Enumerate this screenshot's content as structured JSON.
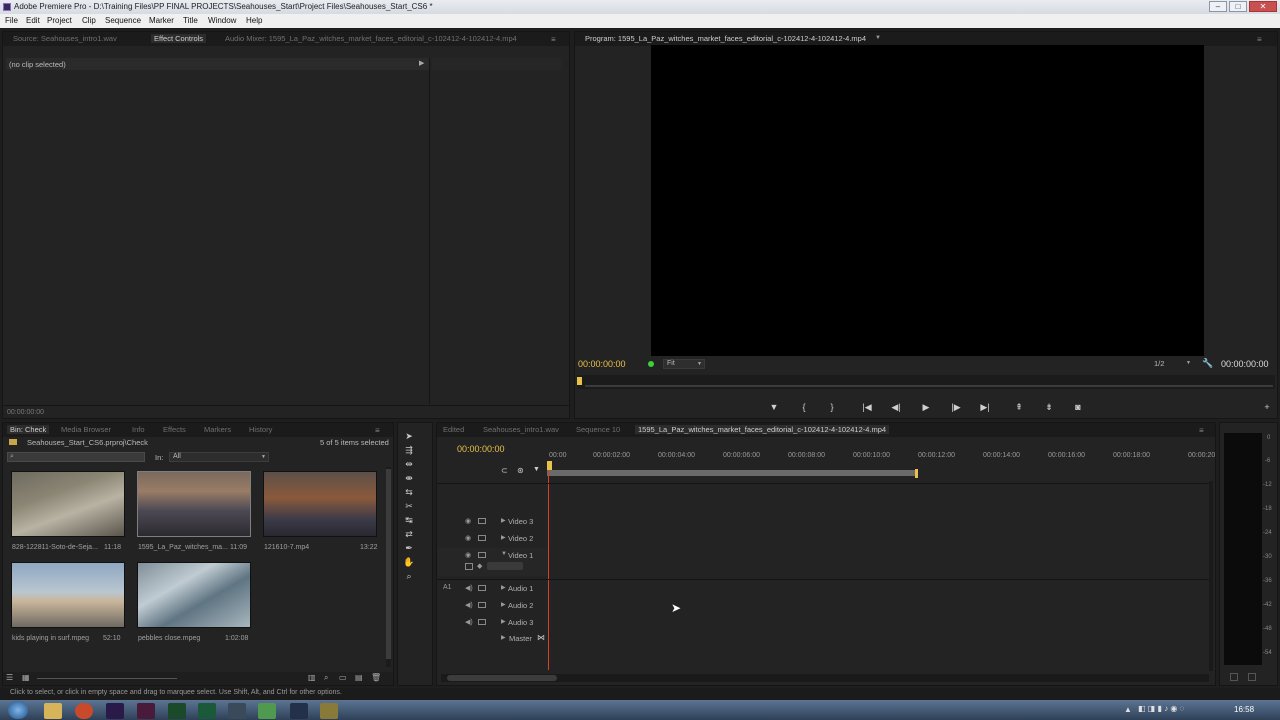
{
  "window": {
    "title": "Adobe Premiere Pro - D:\\Training Files\\PP FINAL PROJECTS\\Seahouses_Start\\Project Files\\Seahouses_Start_CS6 *"
  },
  "menu": [
    "File",
    "Edit",
    "Project",
    "Clip",
    "Sequence",
    "Marker",
    "Title",
    "Window",
    "Help"
  ],
  "source_panel": {
    "tabs": [
      "Source: Seahouses_intro1.wav",
      "Effect Controls",
      "Audio Mixer: 1595_La_Paz_witches_market_faces_editorial_c-102412-4-102412-4.mp4"
    ],
    "active_tab": 1,
    "no_clip": "(no clip selected)",
    "timecode": "00:00:00:00"
  },
  "program_monitor": {
    "title": "Program: 1595_La_Paz_witches_market_faces_editorial_c-102412-4-102412-4.mp4",
    "timecode_left": "00:00:00:00",
    "fit": "Fit",
    "resolution": "1/2",
    "timecode_right": "00:00:00:00"
  },
  "project_panel": {
    "tabs": [
      "Bin: Check",
      "Media Browser",
      "Info",
      "Effects",
      "Markers",
      "History"
    ],
    "active_tab": 0,
    "path": "Seahouses_Start_CS6.prproj\\Check",
    "items_selected": "5 of 5 items selected",
    "in_label": "In:",
    "in_value": "All",
    "clips": [
      {
        "name": "828-122811-Soto-de-Seja...",
        "duration": "11:18"
      },
      {
        "name": "1595_La_Paz_witches_ma...",
        "duration": "11:09"
      },
      {
        "name": "121610-7.mp4",
        "duration": "13:22"
      },
      {
        "name": "kids playing in surf.mpeg",
        "duration": "52:10"
      },
      {
        "name": "pebbles close.mpeg",
        "duration": "1:02:08"
      }
    ]
  },
  "timeline": {
    "tabs": [
      "Edited",
      "Seahouses_intro1.wav",
      "Sequence 10",
      "1595_La_Paz_witches_market_faces_editorial_c-102412-4-102412-4.mp4"
    ],
    "active_tab": 3,
    "timecode": "00:00:00:00",
    "ruler": [
      "00:00",
      "00:00:02:00",
      "00:00:04:00",
      "00:00:06:00",
      "00:00:08:00",
      "00:00:10:00",
      "00:00:12:00",
      "00:00:14:00",
      "00:00:16:00",
      "00:00:18:00",
      "00:00:20"
    ],
    "video_tracks": [
      "Video 3",
      "Video 2",
      "Video 1"
    ],
    "audio_tracks": [
      "Audio 1",
      "Audio 2",
      "Audio 3"
    ],
    "master": "Master",
    "a1_label": "A1"
  },
  "meter_ticks": [
    "0",
    "-6",
    "-12",
    "-18",
    "-24",
    "-30",
    "-36",
    "-42",
    "-48",
    "-54"
  ],
  "status_bar": "Click to select, or click in empty space and drag to marquee select. Use Shift, Alt, and Ctrl for other options.",
  "taskbar": {
    "clock": "16:58"
  },
  "colors": {
    "timecode": "#e9c24a",
    "playhead": "#d9402b",
    "accent_green": "#3ad13a"
  }
}
